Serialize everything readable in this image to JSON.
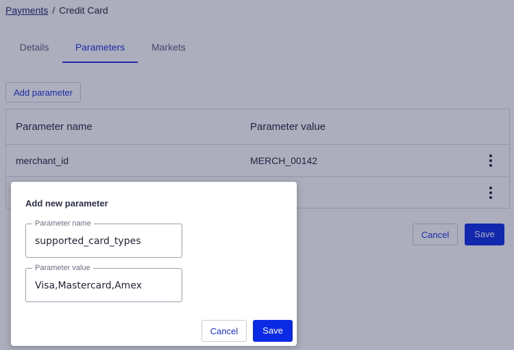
{
  "breadcrumb": {
    "parent": "Payments",
    "separator": "/",
    "current": "Credit Card"
  },
  "tabs": [
    {
      "label": "Details",
      "active": false
    },
    {
      "label": "Parameters",
      "active": true
    },
    {
      "label": "Markets",
      "active": false
    }
  ],
  "toolbar": {
    "add_parameter_label": "Add parameter"
  },
  "table": {
    "columns": [
      "Parameter name",
      "Parameter value"
    ],
    "rows": [
      {
        "name": "merchant_id",
        "value": "MERCH_00142"
      },
      {
        "name": "",
        "value": ""
      }
    ]
  },
  "page_actions": {
    "cancel_label": "Cancel",
    "save_label": "Save"
  },
  "dialog": {
    "title": "Add new parameter",
    "name_field": {
      "label": "Parameter name",
      "value": "supported_card_types"
    },
    "value_field": {
      "label": "Parameter value",
      "value": "Visa,Mastercard,Amex"
    },
    "cancel_label": "Cancel",
    "save_label": "Save"
  },
  "colors": {
    "accent": "#0a2ae6",
    "link": "#1a2fd9",
    "overlay": "#1e2450"
  }
}
